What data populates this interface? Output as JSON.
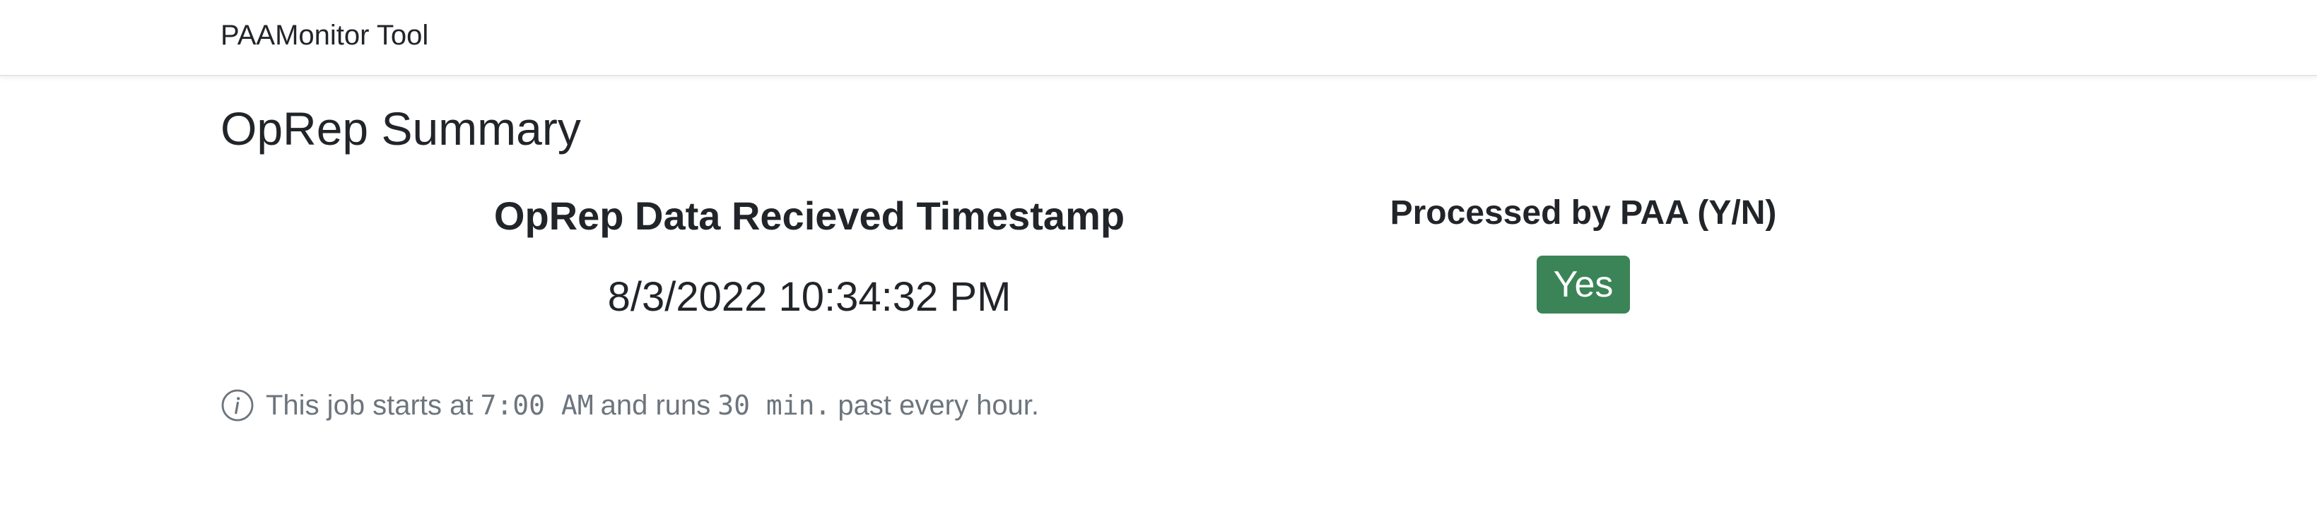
{
  "navbar": {
    "brand": "PAAMonitor Tool"
  },
  "page": {
    "title": "OpRep Summary"
  },
  "summary": {
    "timestamp_heading": "OpRep Data Recieved Timestamp",
    "timestamp_value": "8/3/2022 10:34:32 PM",
    "processed_heading": "Processed by PAA (Y/N)",
    "processed_value": "Yes",
    "processed_color": "#3b8457"
  },
  "note": {
    "icon": "info-icon",
    "prefix": "This job starts at",
    "start_time": "7:00 AM",
    "middle": "and runs",
    "interval": "30 min.",
    "suffix": "past every hour."
  }
}
